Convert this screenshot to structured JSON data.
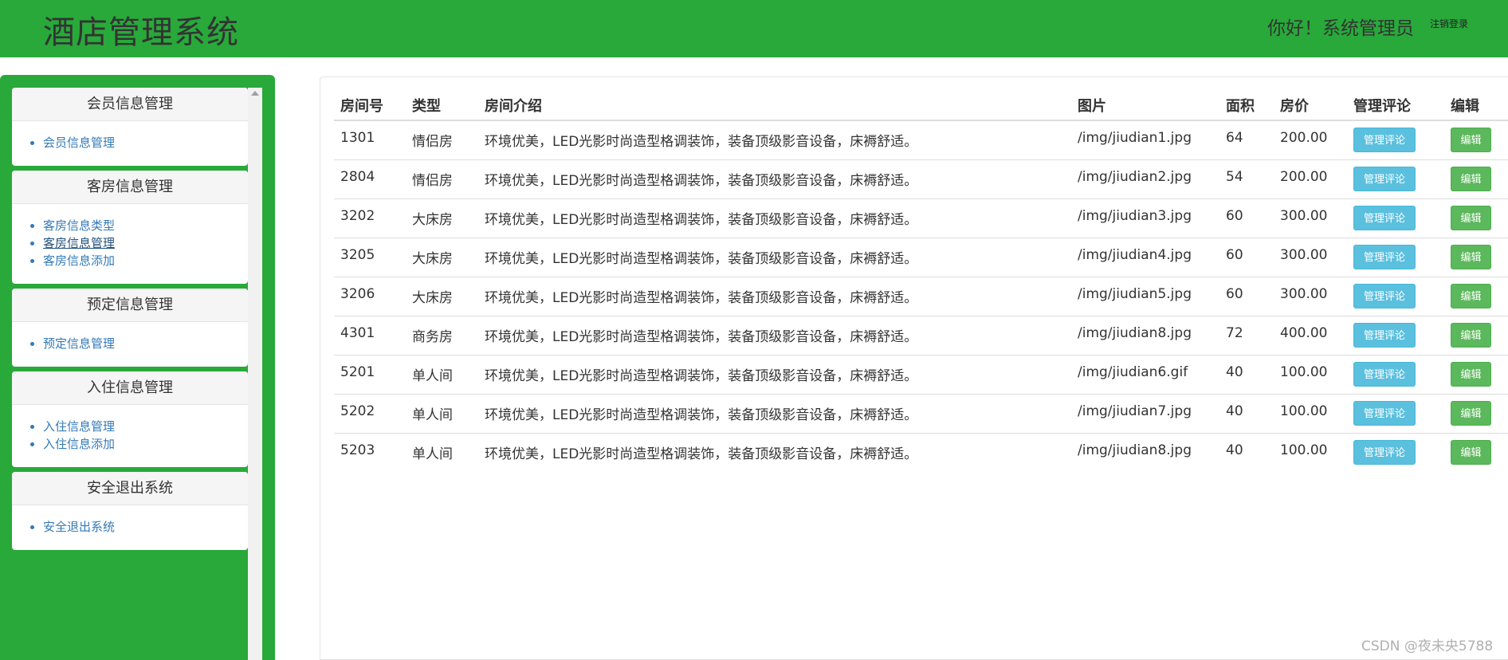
{
  "header": {
    "title": "酒店管理系统",
    "greeting": "你好！系统管理员",
    "logout": "注销登录"
  },
  "sidebar": {
    "panels": [
      {
        "title": "会员信息管理",
        "items": [
          "会员信息管理"
        ]
      },
      {
        "title": "客房信息管理",
        "items": [
          "客房信息类型",
          "客房信息管理",
          "客房信息添加"
        ]
      },
      {
        "title": "预定信息管理",
        "items": [
          "预定信息管理"
        ]
      },
      {
        "title": "入住信息管理",
        "items": [
          "入住信息管理",
          "入住信息添加"
        ]
      },
      {
        "title": "安全退出系统",
        "items": [
          "安全退出系统"
        ]
      }
    ]
  },
  "table": {
    "headers": [
      "房间号",
      "类型",
      "房间介绍",
      "图片",
      "面积",
      "房价",
      "管理评论",
      "编辑"
    ],
    "comment_button": "管理评论",
    "edit_button": "编辑",
    "rows": [
      [
        "1301",
        "情侣房",
        "环境优美，LED光影时尚造型格调装饰，装备顶级影音设备，床褥舒适。",
        "/img/jiudian1.jpg",
        "64",
        "200.00"
      ],
      [
        "2804",
        "情侣房",
        "环境优美，LED光影时尚造型格调装饰，装备顶级影音设备，床褥舒适。",
        "/img/jiudian2.jpg",
        "54",
        "200.00"
      ],
      [
        "3202",
        "大床房",
        "环境优美，LED光影时尚造型格调装饰，装备顶级影音设备，床褥舒适。",
        "/img/jiudian3.jpg",
        "60",
        "300.00"
      ],
      [
        "3205",
        "大床房",
        "环境优美，LED光影时尚造型格调装饰，装备顶级影音设备，床褥舒适。",
        "/img/jiudian4.jpg",
        "60",
        "300.00"
      ],
      [
        "3206",
        "大床房",
        "环境优美，LED光影时尚造型格调装饰，装备顶级影音设备，床褥舒适。",
        "/img/jiudian5.jpg",
        "60",
        "300.00"
      ],
      [
        "4301",
        "商务房",
        "环境优美，LED光影时尚造型格调装饰，装备顶级影音设备，床褥舒适。",
        "/img/jiudian8.jpg",
        "72",
        "400.00"
      ],
      [
        "5201",
        "单人间",
        "环境优美，LED光影时尚造型格调装饰，装备顶级影音设备，床褥舒适。",
        "/img/jiudian6.gif",
        "40",
        "100.00"
      ],
      [
        "5202",
        "单人间",
        "环境优美，LED光影时尚造型格调装饰，装备顶级影音设备，床褥舒适。",
        "/img/jiudian7.jpg",
        "40",
        "100.00"
      ],
      [
        "5203",
        "单人间",
        "环境优美，LED光影时尚造型格调装饰，装备顶级影音设备，床褥舒适。",
        "/img/jiudian8.jpg",
        "40",
        "100.00"
      ]
    ]
  },
  "watermark": "CSDN @夜未央5788",
  "colors": {
    "brand_green": "#28a93a",
    "info_button": "#5bc0de",
    "success_button": "#5cb85c"
  }
}
